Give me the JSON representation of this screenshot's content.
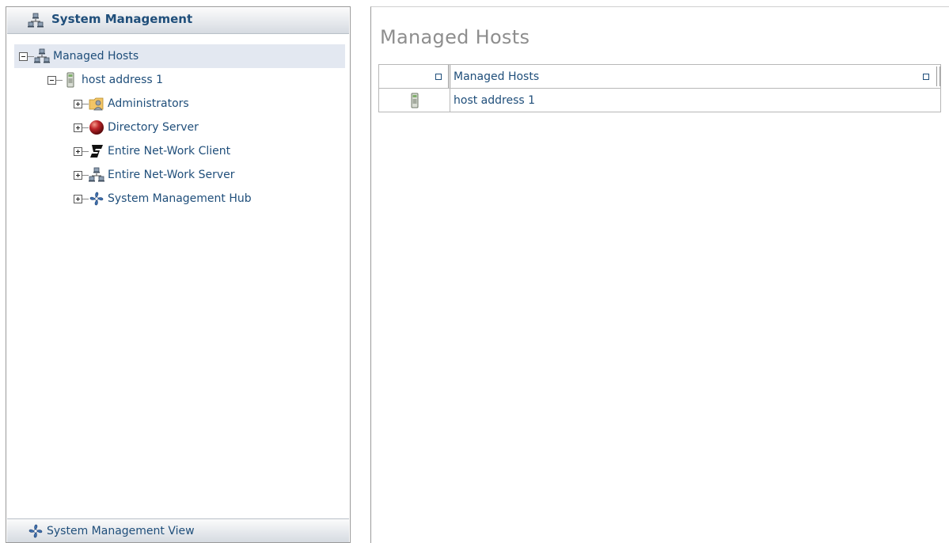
{
  "nav": {
    "header_title": "System Management",
    "footer_label": "System Management View",
    "tree": [
      {
        "label": "Managed Hosts",
        "icon": "network-icon",
        "expanded": true,
        "selected": true
      },
      {
        "label": "host address 1",
        "icon": "host-icon",
        "expanded": true
      },
      {
        "label": "Administrators",
        "icon": "administrators-icon",
        "expanded": false
      },
      {
        "label": "Directory Server",
        "icon": "directory-server-icon",
        "expanded": false
      },
      {
        "label": "Entire Net-Work Client",
        "icon": "network-client-icon",
        "expanded": false
      },
      {
        "label": "Entire Net-Work Server",
        "icon": "network-icon",
        "expanded": false
      },
      {
        "label": "System Management Hub",
        "icon": "smh-icon",
        "expanded": false
      }
    ]
  },
  "main": {
    "title": "Managed Hosts",
    "table": {
      "columns": [
        "",
        "Managed Hosts"
      ],
      "rows": [
        {
          "icon": "host-icon",
          "name": "host address 1"
        }
      ]
    }
  },
  "colors": {
    "link_text": "#1f4e7a",
    "title_gray": "#8e8e8e",
    "selection_bg": "#e3e8f1",
    "border": "#9a9a9a"
  }
}
